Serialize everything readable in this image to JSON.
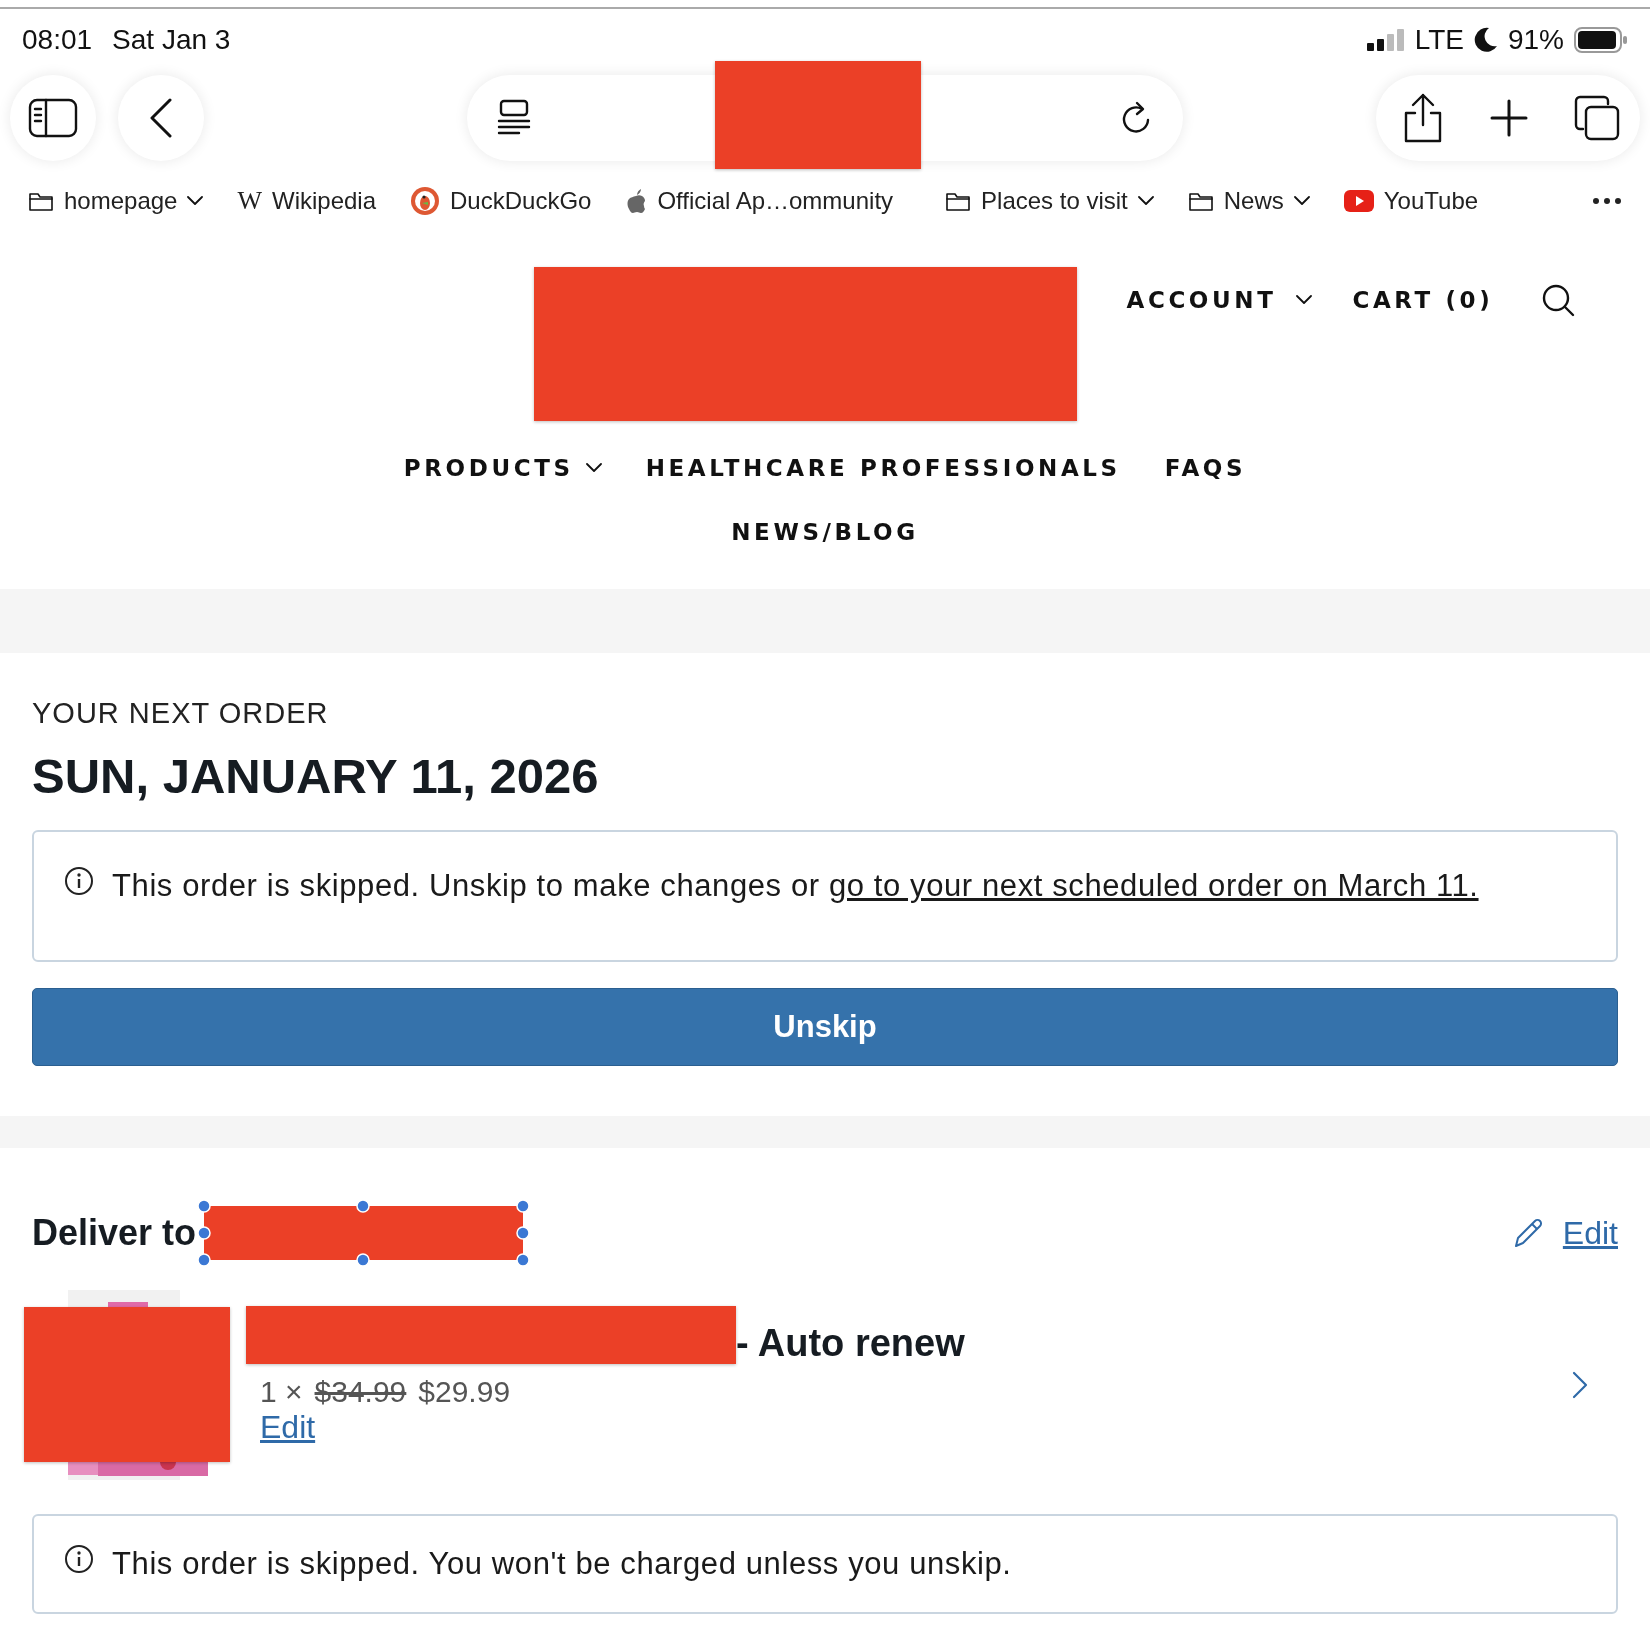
{
  "status_bar": {
    "time": "08:01",
    "date": "Sat Jan 3",
    "network": "LTE",
    "battery": "91%"
  },
  "bookmarks": [
    {
      "kind": "folder",
      "label": "homepage",
      "menu": true
    },
    {
      "kind": "letter",
      "icon": "W",
      "label": "Wikipedia",
      "menu": false
    },
    {
      "kind": "duck",
      "label": "DuckDuckGo",
      "menu": false
    },
    {
      "kind": "apple",
      "label": "Official Ap…ommunity",
      "menu": false
    },
    {
      "kind": "folder",
      "label": "Places to visit",
      "menu": true
    },
    {
      "kind": "folder",
      "label": "News",
      "menu": true
    },
    {
      "kind": "video",
      "label": "YouTube",
      "menu": false
    }
  ],
  "site_header": {
    "account": "ACCOUNT",
    "cart": "CART (0)",
    "nav": [
      {
        "label": "PRODUCTS",
        "dropdown": true
      },
      {
        "label": "HEALTHCARE PROFESSIONALS",
        "dropdown": false
      },
      {
        "label": "FAQS",
        "dropdown": false
      },
      {
        "label": "NEWS/BLOG",
        "dropdown": false
      }
    ]
  },
  "next_order": {
    "eyebrow": "YOUR NEXT ORDER",
    "date": "SUN, JANUARY 11, 2026",
    "notice": {
      "text": "This order is skipped. Unskip to make changes or",
      "link": "go to your next scheduled order on March 11."
    },
    "button": "Unskip"
  },
  "delivery": {
    "heading": "Deliver to",
    "edit": "Edit",
    "items": [
      {
        "title": "- Auto renew",
        "quantity": "1 ×",
        "original_price": "$34.99",
        "price": "$29.99",
        "edit": "Edit"
      }
    ],
    "notice": "This order is skipped. You won't be charged unless you unskip."
  }
}
